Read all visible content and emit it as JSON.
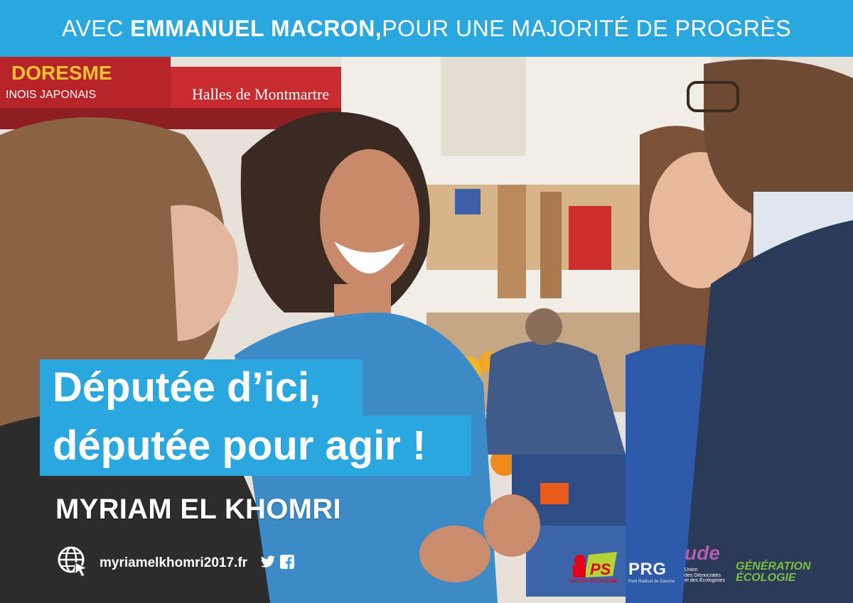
{
  "banner": {
    "prefix": "AVEC ",
    "name": "EMMANUEL MACRON,",
    "suffix": " POUR UNE MAJORITÉ DE PROGRÈS"
  },
  "scene_signs": {
    "shop_top": "DORESME",
    "shop_sub": "INOIS JAPONAIS",
    "shop_name": "Halles de Montmartre"
  },
  "headline": {
    "line1": "Députée d’ici,",
    "line2": "députée pour agir !"
  },
  "candidate": {
    "name": "MYRIAM EL KHOMRI"
  },
  "contact": {
    "website": "myriamelkhomri2017.fr",
    "icons": [
      "globe-cursor-icon",
      "twitter-icon",
      "facebook-icon"
    ]
  },
  "party_logos": {
    "ps": {
      "mark": "PS",
      "sub": "SOCIAL-ÉCOLOGIE"
    },
    "prg": {
      "mark": "PRG",
      "sub": "Parti Radical de Gauche"
    },
    "ude": {
      "mark": "ude",
      "sub1": "Union",
      "sub2": "des Démocrates",
      "sub3": "et des Écologistes"
    },
    "ge": {
      "line1": "GÉNÉRATION",
      "line2": "ÉCOLOGIE"
    }
  },
  "colors": {
    "brand_blue": "#2aa7de",
    "text_white": "#ffffff",
    "ps_red": "#e2001a",
    "ge_green": "#7bbd3e"
  }
}
